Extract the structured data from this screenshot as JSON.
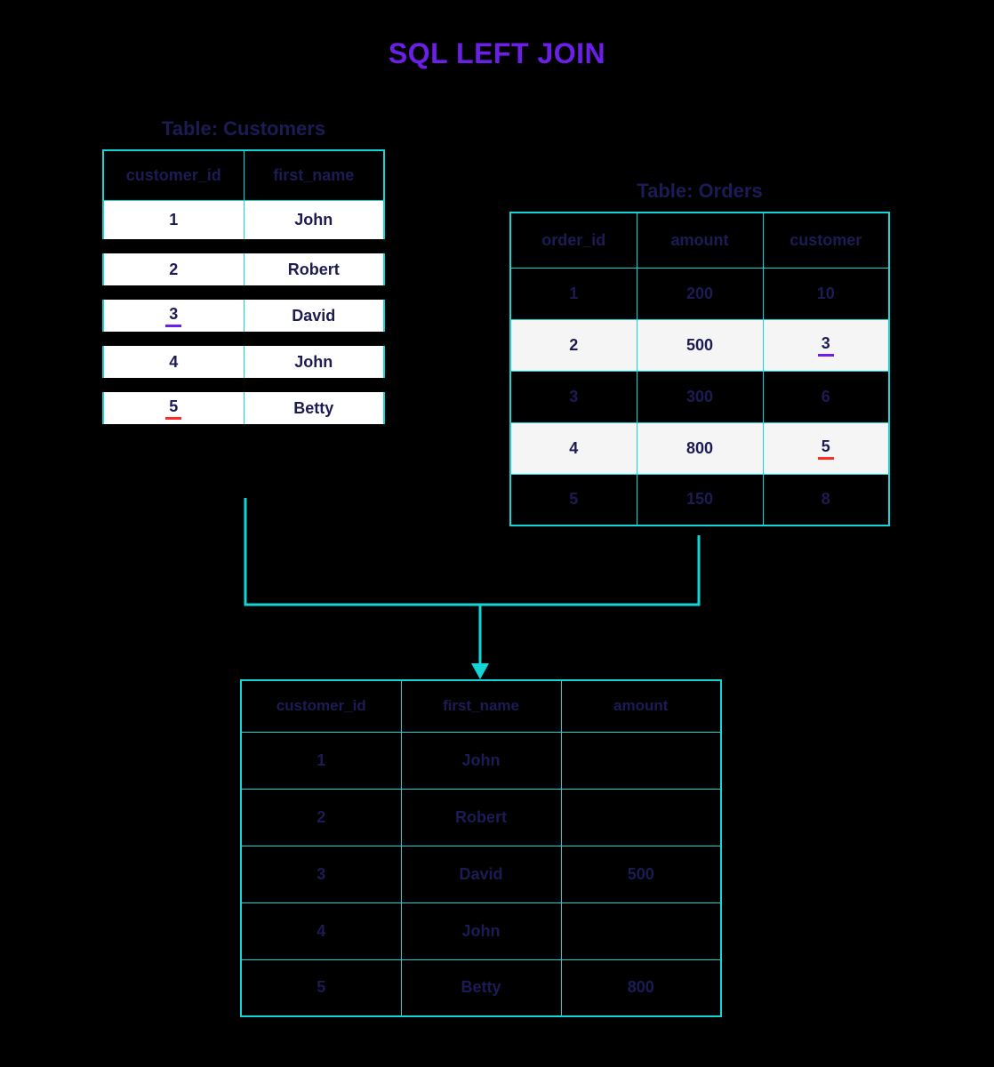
{
  "title": "SQL LEFT JOIN",
  "customers": {
    "label": "Table: Customers",
    "headers": {
      "c0": "customer_id",
      "c1": "first_name"
    },
    "rows": [
      {
        "id": "1",
        "name": "John",
        "ul": "none"
      },
      {
        "id": "2",
        "name": "Robert",
        "ul": "none"
      },
      {
        "id": "3",
        "name": "David",
        "ul": "purple"
      },
      {
        "id": "4",
        "name": "John",
        "ul": "none"
      },
      {
        "id": "5",
        "name": "Betty",
        "ul": "red"
      }
    ]
  },
  "orders": {
    "label": "Table: Orders",
    "headers": {
      "c0": "order_id",
      "c1": "amount",
      "c2": "customer"
    },
    "rows": [
      {
        "oid": "1",
        "amt": "200",
        "cust": "10",
        "hl": false,
        "ul": "none"
      },
      {
        "oid": "2",
        "amt": "500",
        "cust": "3",
        "hl": true,
        "ul": "purple"
      },
      {
        "oid": "3",
        "amt": "300",
        "cust": "6",
        "hl": false,
        "ul": "none"
      },
      {
        "oid": "4",
        "amt": "800",
        "cust": "5",
        "hl": true,
        "ul": "red"
      },
      {
        "oid": "5",
        "amt": "150",
        "cust": "8",
        "hl": false,
        "ul": "none"
      }
    ]
  },
  "result": {
    "headers": {
      "c0": "customer_id",
      "c1": "first_name",
      "c2": "amount"
    },
    "rows": [
      {
        "id": "1",
        "name": "John",
        "amt": ""
      },
      {
        "id": "2",
        "name": "Robert",
        "amt": ""
      },
      {
        "id": "3",
        "name": "David",
        "amt": "500"
      },
      {
        "id": "4",
        "name": "John",
        "amt": ""
      },
      {
        "id": "5",
        "name": "Betty",
        "amt": "800"
      }
    ]
  }
}
